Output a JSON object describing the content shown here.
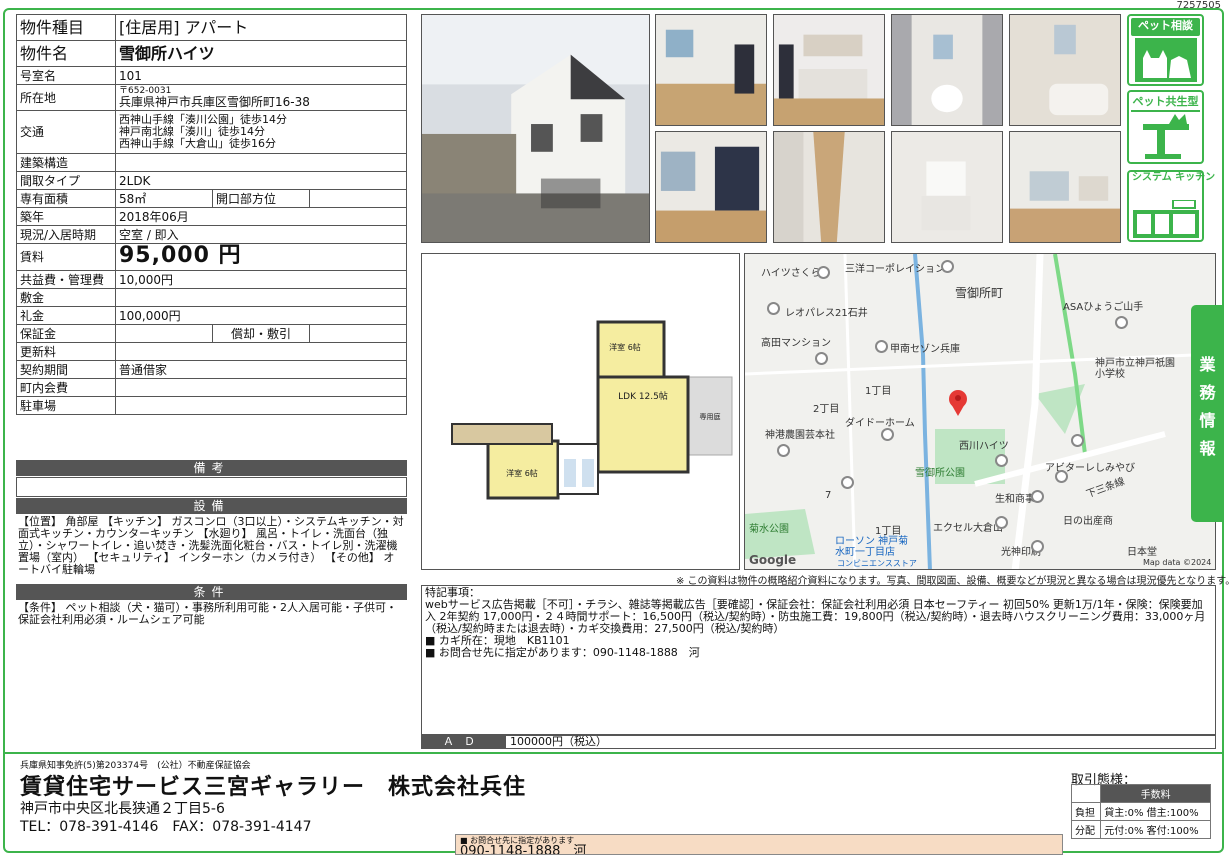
{
  "doc_id": "7257505",
  "property": {
    "type_label": "物件種目",
    "type_value": "[住居用] アパート",
    "name_label": "物件名",
    "name_value": "雪御所ハイツ",
    "room_label": "号室名",
    "room_value": "101",
    "location_label": "所在地",
    "zip": "〒652-0031",
    "address": "兵庫県神戸市兵庫区雪御所町16-38",
    "transport_label": "交通",
    "transport": [
      "西神山手線「湊川公園」徒歩14分",
      "神戸南北線「湊川」徒歩14分",
      "西神山手線「大倉山」徒歩16分"
    ],
    "structure_label": "建築構造",
    "structure_value": "",
    "layout_label": "間取タイプ",
    "layout_value": "2LDK",
    "area_label": "専有面積",
    "area_value": "58㎡",
    "opening_label": "開口部方位",
    "opening_value": "",
    "built_label": "築年",
    "built_value": "2018年06月",
    "status_label": "現況/入居時期",
    "status_value": "空室 / 即入",
    "rent_label": "賃料",
    "rent_value": "95,000 円",
    "common_label": "共益費・管理費",
    "common_value": "10,000円",
    "deposit_label": "敷金",
    "deposit_value": "",
    "key_money_label": "礼金",
    "key_money_value": "100,000円",
    "guarantee_label": "保証金",
    "guarantee_value": "",
    "amortize_label": "償却・敷引",
    "amortize_value": "",
    "renewal_label": "更新料",
    "renewal_value": "",
    "contract_label": "契約期間",
    "contract_value": "普通借家",
    "community_label": "町内会費",
    "community_value": "",
    "parking_label": "駐車場",
    "parking_value": ""
  },
  "sections": {
    "remarks_title": "備考",
    "remarks_body": "",
    "equipment_title": "設備",
    "equipment_body": "【位置】 角部屋 【キッチン】 ガスコンロ（3口以上）・システムキッチン・対面式キッチン・カウンターキッチン 【水廻り】 風呂・トイレ・洗面台（独立）・シャワートイレ・追い焚き・洗髪洗面化粧台・バス・トイレ別・洗濯機置場（室内） 【セキュリティ】 インターホン（カメラ付き） 【その他】 オートバイ駐輪場",
    "conditions_title": "条件",
    "conditions_body": "【条件】 ペット相談（犬・猫可）・事務所利用可能・2人入居可能・子供可・保証会社利用必須・ルームシェア可能"
  },
  "badges": [
    "ペット相談",
    "ペット共生型",
    "システム キッチン"
  ],
  "floorplan": {
    "rooms": [
      "洋室 6帖",
      "LDK 12.5帖",
      "洋室 6帖",
      "専用庭"
    ]
  },
  "map": {
    "labels": [
      "ハイツさくら",
      "三洋コーポレイション",
      "雪御所町",
      "レオパレス21石井",
      "ASAひょうご山手",
      "高田マンション",
      "甲南セゾン兵庫",
      "神戸市立神戸祇園小学校",
      "1丁目",
      "2丁目",
      "ダイドーホーム",
      "神港農園芸本社",
      "西川ハイツ",
      "アビターレしみやび",
      "下三条線",
      "雪御所公園",
      "生和商事",
      "日の出産商",
      "菊水公園",
      "1丁目",
      "エクセル大倉山",
      "ローソン 神戸菊水町一丁目店",
      "コンビニエンスストア",
      "光神印刷",
      "日本堂",
      "7",
      "Google",
      "Map data ©2024"
    ]
  },
  "note": "※ この資料は物件の概略紹介資料になります。写真、間取図面、設備、概要などが現況と異なる場合は現況優先となります。",
  "special": {
    "title": "特記事項：",
    "lines": [
      "webサービス広告掲載［不可］・チラシ、雑誌等掲載広告［要確認］・保証会社：保証会社利用必須 日本セーフティー 初回50% 更新1万/1年・保険：保険要加入 2年契約 17,000円・２４時間サポート：16,500円（税込/契約時）・防虫施工費：19,800円（税込/契約時）・退去時ハウスクリーニング費用：33,000ヶ月（税込/契約時または退去時）・カギ交換費用：27,500円（税込/契約時）",
      "■ カギ所在：現地　KB1101",
      "■ お問合せ先に指定があります：090-1148-1888　河"
    ]
  },
  "ad": {
    "label": "ＡＤ",
    "value": "100000円（税込）"
  },
  "side_tab": [
    "業",
    "務",
    "情",
    "報"
  ],
  "footer": {
    "license": "兵庫県知事免許(5)第203374号　(公社）不動産保証協会",
    "company": "賃貸住宅サービス三宮ギャラリー　株式会社兵住",
    "address": "神戸市中央区北長狭通２丁目5-6",
    "tel": "TEL：078-391-4146　FAX：078-391-4147",
    "inquiry_small": "■ お問合せ先に指定があります",
    "inquiry_big": "090-1148-1888　河"
  },
  "terms": {
    "title": "取引態様：",
    "header": "手数料",
    "rows": [
      [
        "負担",
        "貸主:0% 借主:100%"
      ],
      [
        "分配",
        "元付:0% 客付:100%"
      ]
    ]
  },
  "colors": {
    "accent": "#3cb44b",
    "section_head": "#555555",
    "inquiry_bg": "#f7dcc4"
  }
}
